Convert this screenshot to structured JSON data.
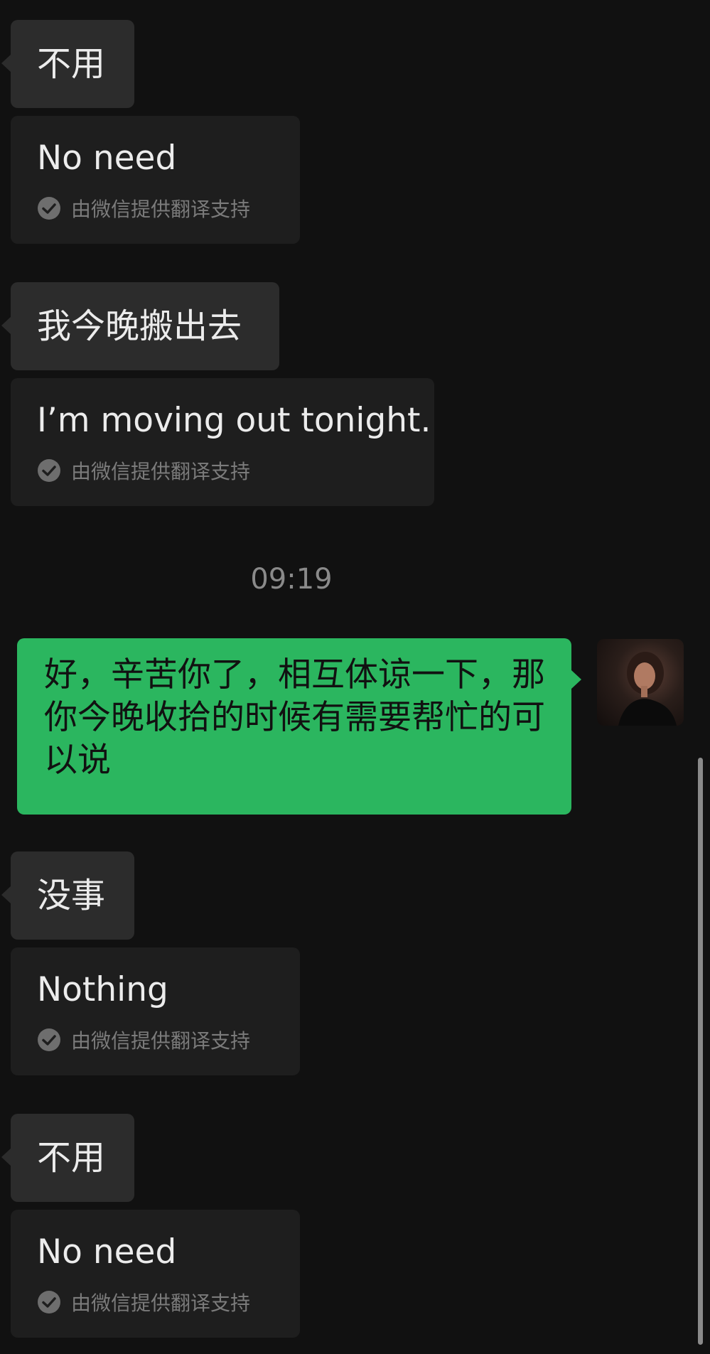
{
  "colors": {
    "background": "#111111",
    "incoming_bubble": "#2c2c2c",
    "translation_bubble": "#1e1e1e",
    "outgoing_bubble": "#2bb65f",
    "credit_text": "#7b7b7b"
  },
  "messages": [
    {
      "text": "不用",
      "translation": "No need"
    },
    {
      "text": "我今晚搬出去",
      "translation": "I’m moving out tonight."
    },
    {
      "text": "没事",
      "translation": "Nothing"
    },
    {
      "text": "不用",
      "translation": "No need"
    }
  ],
  "translation_credit": "由微信提供翻译支持",
  "credit_icon": "check-circle-icon",
  "timestamp": "09:19",
  "outgoing_message": "好，辛苦你了，相互体谅一下，那你今晚收拾的时候有需要帮忙的可以说",
  "avatar_icon": "user-avatar-photo"
}
